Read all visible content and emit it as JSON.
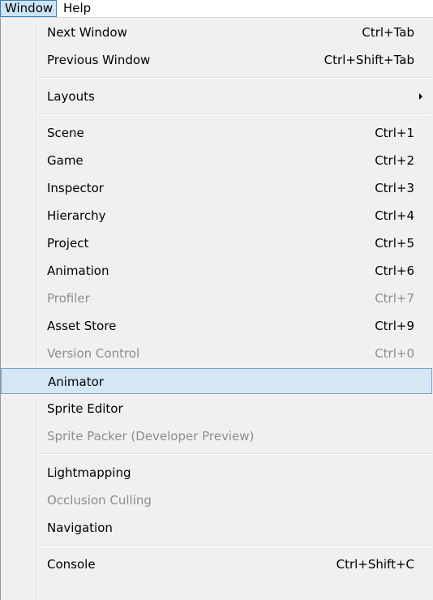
{
  "menubar": {
    "window": "Window",
    "help": "Help"
  },
  "menu": {
    "next_window": {
      "label": "Next Window",
      "shortcut": "Ctrl+Tab"
    },
    "previous_window": {
      "label": "Previous Window",
      "shortcut": "Ctrl+Shift+Tab"
    },
    "layouts": {
      "label": "Layouts"
    },
    "scene": {
      "label": "Scene",
      "shortcut": "Ctrl+1"
    },
    "game": {
      "label": "Game",
      "shortcut": "Ctrl+2"
    },
    "inspector": {
      "label": "Inspector",
      "shortcut": "Ctrl+3"
    },
    "hierarchy": {
      "label": "Hierarchy",
      "shortcut": "Ctrl+4"
    },
    "project": {
      "label": "Project",
      "shortcut": "Ctrl+5"
    },
    "animation": {
      "label": "Animation",
      "shortcut": "Ctrl+6"
    },
    "profiler": {
      "label": "Profiler",
      "shortcut": "Ctrl+7"
    },
    "asset_store": {
      "label": "Asset Store",
      "shortcut": "Ctrl+9"
    },
    "version_control": {
      "label": "Version Control",
      "shortcut": "Ctrl+0"
    },
    "animator": {
      "label": "Animator"
    },
    "sprite_editor": {
      "label": "Sprite Editor"
    },
    "sprite_packer": {
      "label": "Sprite Packer (Developer Preview)"
    },
    "lightmapping": {
      "label": "Lightmapping"
    },
    "occlusion_culling": {
      "label": "Occlusion Culling"
    },
    "navigation": {
      "label": "Navigation"
    },
    "console": {
      "label": "Console",
      "shortcut": "Ctrl+Shift+C"
    }
  },
  "colors": {
    "highlight": "#d5e6f5",
    "disabled_text": "#8d8d8d",
    "menu_background": "#f0f0f0"
  },
  "icons": {
    "submenu": "chevron-right-icon"
  }
}
